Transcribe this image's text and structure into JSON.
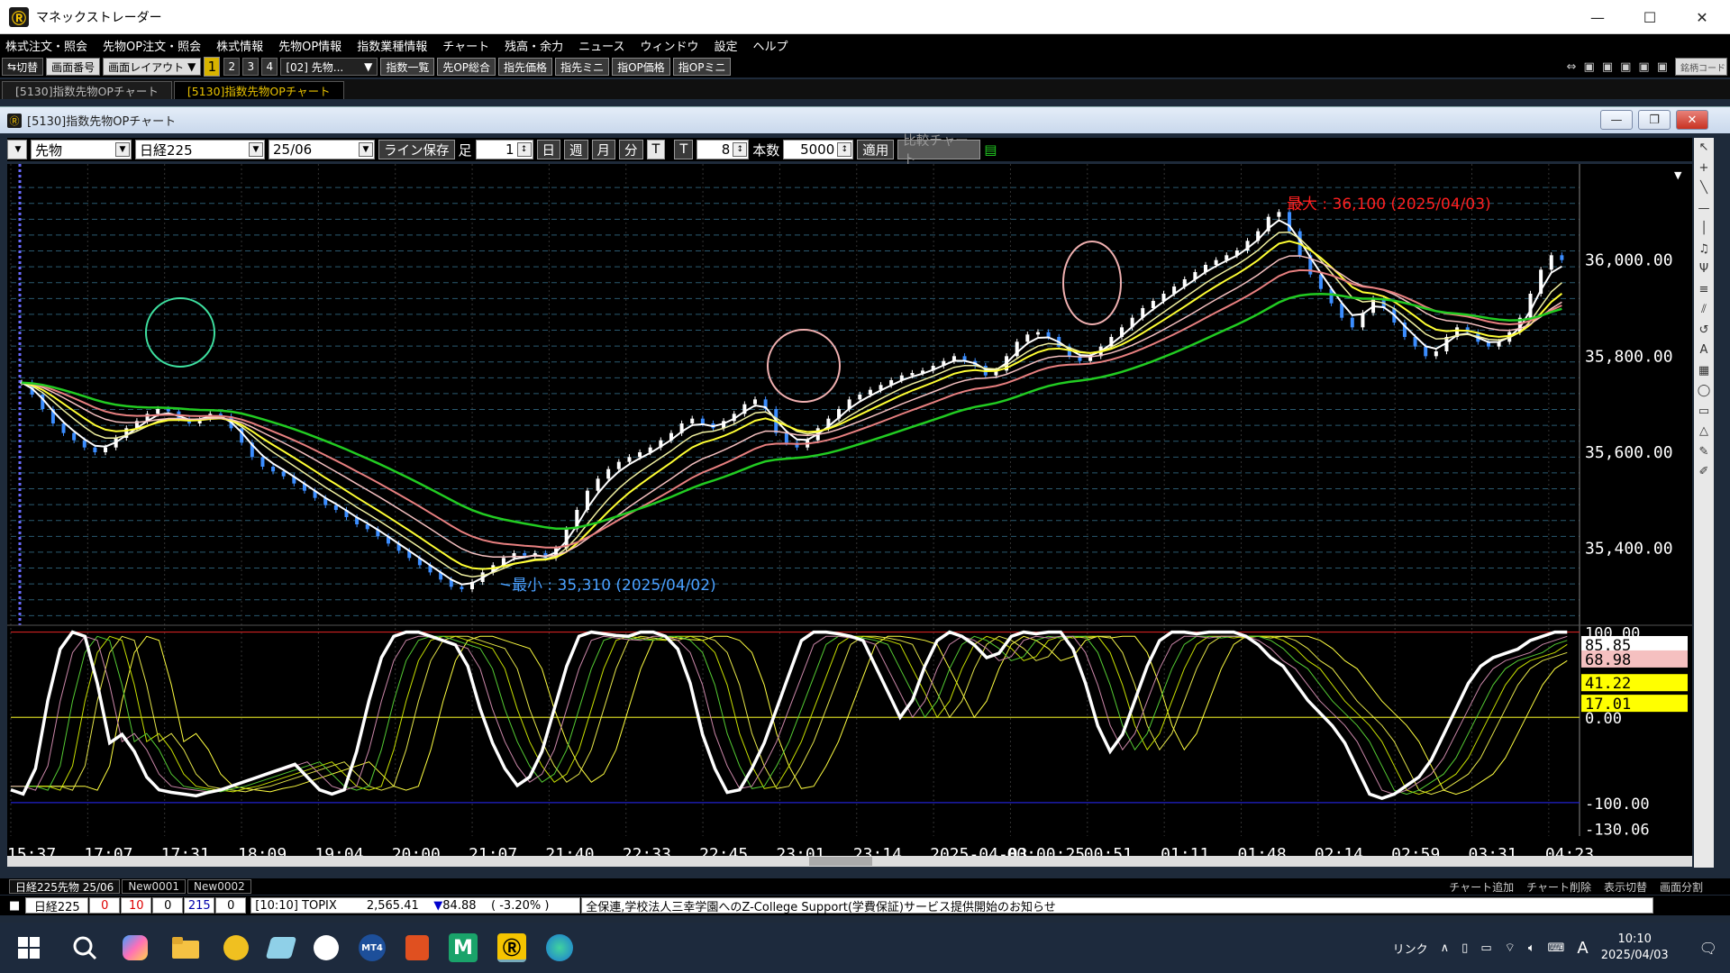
{
  "window": {
    "title": "マネックストレーダー"
  },
  "menu": [
    "株式注文・照会",
    "先物OP注文・照会",
    "株式情報",
    "先物OP情報",
    "指数業種情報",
    "チャート",
    "残高・余力",
    "ニュース",
    "ウィンドウ",
    "設定",
    "ヘルプ"
  ],
  "toolbar": {
    "switch": "切替",
    "screen_no": "画面番号",
    "layout": "画面レイアウト",
    "pages": [
      "1",
      "2",
      "3",
      "4"
    ],
    "preset": "[02] 先物...",
    "buttons": [
      "指数一覧",
      "先OP総合",
      "指先価格",
      "指先ミニ",
      "指OP価格",
      "指OPミニ"
    ],
    "search": "銘柄コード"
  },
  "tabs": [
    "[5130]指数先物OPチャート",
    "[5130]指数先物OPチャート"
  ],
  "subwindow": {
    "title": "[5130]指数先物OPチャート"
  },
  "chartbar": {
    "type": "先物",
    "index": "日経225",
    "month": "25/06",
    "line_save": "ライン保存",
    "foot": "足",
    "foot_val": "1",
    "periods": [
      "日",
      "週",
      "月",
      "分",
      "T"
    ],
    "t_label": "T",
    "t_val": "8",
    "count_label": "本数",
    "count_val": "5000",
    "apply": "適用",
    "compare": "比較チャート"
  },
  "chart_data": [
    {
      "type": "candlestick",
      "max_label": "最大 : 36,100 (2025/04/03)",
      "min_label": "最小 : 35,310 (2025/04/02)",
      "y_ticks": [
        "36,000.00",
        "35,800.00",
        "35,600.00",
        "35,400.00"
      ],
      "x_labels": [
        "15:37",
        "17:07",
        "17:31",
        "18:09",
        "19:04",
        "20:00",
        "21:07",
        "21:40",
        "22:33",
        "22:45",
        "23:01",
        "23:14",
        "2025-04-03",
        "00:00:25",
        "00:51",
        "01:11",
        "01:48",
        "02:14",
        "02:59",
        "03:31",
        "04:23"
      ],
      "close": [
        35745,
        35720,
        35690,
        35660,
        35640,
        35625,
        35610,
        35600,
        35610,
        35630,
        35650,
        35665,
        35680,
        35690,
        35685,
        35670,
        35660,
        35670,
        35680,
        35675,
        35650,
        35620,
        35590,
        35570,
        35560,
        35550,
        35535,
        35520,
        35505,
        35490,
        35480,
        35465,
        35450,
        35440,
        35425,
        35410,
        35395,
        35380,
        35365,
        35350,
        35335,
        35320,
        35315,
        35330,
        35350,
        35365,
        35380,
        35390,
        35385,
        35390,
        35380,
        35400,
        35440,
        35480,
        35520,
        35545,
        35565,
        35580,
        35590,
        35600,
        35610,
        35625,
        35640,
        35660,
        35670,
        35660,
        35650,
        35665,
        35680,
        35700,
        35710,
        35690,
        35640,
        35620,
        35610,
        35625,
        35650,
        35670,
        35690,
        35710,
        35720,
        35730,
        35740,
        35750,
        35760,
        35765,
        35770,
        35780,
        35790,
        35800,
        35790,
        35780,
        35760,
        35770,
        35800,
        35830,
        35845,
        35850,
        35840,
        35820,
        35800,
        35790,
        35800,
        35820,
        35840,
        35860,
        35880,
        35900,
        35915,
        35930,
        35945,
        35960,
        35975,
        35990,
        36000,
        36010,
        36020,
        36040,
        36060,
        36090,
        36100,
        36060,
        36010,
        35970,
        35940,
        35910,
        35880,
        35860,
        35890,
        35920,
        35900,
        35870,
        35840,
        35820,
        35800,
        35810,
        35840,
        35860,
        35850,
        35830,
        35820,
        35830,
        35850,
        35880,
        35930,
        35980,
        36010,
        36000
      ]
    },
    {
      "type": "line",
      "name": "stochastic",
      "y_ticks": [
        "100.00",
        "0.00",
        "-100.00",
        "-130.06"
      ],
      "values_right": [
        "85.85",
        "68.98",
        "41.22",
        "17.01"
      ],
      "series": [
        -85,
        -90,
        -60,
        20,
        80,
        100,
        95,
        40,
        -30,
        -20,
        -40,
        -70,
        -85,
        -88,
        -90,
        -92,
        -88,
        -85,
        -80,
        -75,
        -70,
        -65,
        -60,
        -55,
        -70,
        -85,
        -90,
        -85,
        -40,
        20,
        70,
        95,
        100,
        100,
        95,
        90,
        85,
        60,
        10,
        -30,
        -60,
        -80,
        -70,
        -40,
        10,
        60,
        95,
        100,
        98,
        96,
        95,
        100,
        100,
        95,
        80,
        40,
        -20,
        -60,
        -88,
        -85,
        -60,
        -30,
        10,
        50,
        90,
        100,
        100,
        98,
        95,
        90,
        60,
        30,
        0,
        20,
        60,
        90,
        100,
        95,
        85,
        70,
        75,
        95,
        100,
        98,
        100,
        100,
        80,
        40,
        -10,
        -40,
        -20,
        20,
        60,
        90,
        100,
        100,
        98,
        100,
        100,
        100,
        95,
        85,
        70,
        60,
        40,
        20,
        5,
        -10,
        -30,
        -60,
        -90,
        -95,
        -90,
        -80,
        -70,
        -50,
        -20,
        10,
        40,
        60,
        70,
        75,
        80,
        90,
        95,
        100,
        100
      ]
    }
  ]
}
